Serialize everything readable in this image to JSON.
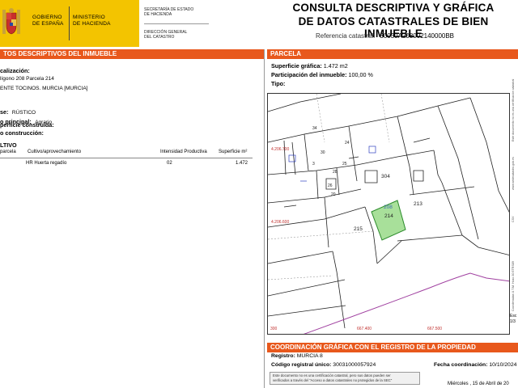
{
  "header": {
    "gov_line1": "GOBIERNO",
    "gov_line2": "DE ESPAÑA",
    "ministry_line1": "MINISTERIO",
    "ministry_line2": "DE HACIENDA",
    "secretaria_line1": "SECRETARÍA DE ESTADO",
    "secretaria_line2": "DE HACIENDA",
    "direccion_line1": "DIRECCIÓN GENERAL",
    "direccion_line2": "DEL CATASTRO",
    "title_line1": "CONSULTA DESCRIPTIVA Y GRÁFICA",
    "title_line2": "DE DATOS CATASTRALES DE BIEN INMUEBLE",
    "ref_label": "Referencia catastral:",
    "ref_value": "30030A208002140000BB",
    "colors": {
      "brand_yellow": "#f3c400",
      "section_orange": "#e8581c",
      "parcel_green": "#a8e09a"
    }
  },
  "left": {
    "section_title": "TOS DESCRIPTIVOS DEL INMUEBLE",
    "localizacion_label": "calización:",
    "loc_line1": "lígono 208 Parcela 214",
    "loc_line2": "ENTE TOCINOS. MURCIA [MURCIA]",
    "clase_label": "se:",
    "clase_value": "RÚSTICO",
    "uso_label": "o principal:",
    "uso_value": "Agrario",
    "sup_cons_label": "perficie construida:",
    "ano_cons_label": "o construcción:",
    "cultivo_title": "LTIVO",
    "table_headers": {
      "sub": "parcela",
      "cultivo": "Cultivo/aprovechamiento",
      "intensidad": "Intensidad Productiva",
      "superficie": "Superficie m²"
    },
    "table_rows": [
      {
        "cultivo": "HR Huerta regadío",
        "intensidad": "02",
        "superficie": "1.472"
      }
    ]
  },
  "right": {
    "section_title": "PARCELA",
    "sup_graf_label": "Superficie gráfica:",
    "sup_graf_value": "1.472 m2",
    "part_label": "Participación del inmueble:",
    "part_value": "100,00 %",
    "tipo_label": "Tipo:",
    "map": {
      "parcel_labels": [
        "304",
        "213",
        "215",
        "208",
        "214",
        "34",
        "30",
        "3",
        "25",
        "24",
        "28",
        "26",
        "20"
      ],
      "axis_x": [
        "300",
        "667.400",
        "667.500"
      ],
      "axis_y": [
        "4.206.700",
        "4.206.600"
      ],
      "escala_label": "Esc",
      "escala_value": "1/3",
      "side_text_1": "Este documento no es una certificación catastral",
      "side_text_2": "www.sedecatastro.gob.es",
      "side_text_3": "CSV:",
      "side_text_4": "Coordenadas U.T.M. Huso 30 ETRS89"
    },
    "coord_title": "COORDINACIÓN GRÁFICA CON EL REGISTRO DE LA PROPIEDAD",
    "registro_label": "Registro:",
    "registro_value": "MURCIA 8",
    "codigo_label": "Código registral único:",
    "codigo_value": "30031000057924",
    "fecha_label": "Fecha coordinación:",
    "fecha_value": "10/10/2024",
    "note_line1": "Este documento no es una certificación catastral, pero sus datos pueden ser",
    "note_line2": "verificados a través del \"Acceso a datos catastrales no protegidos de la SEC\"",
    "footer_date": "Miércoles , 15 de Abril de 20"
  }
}
